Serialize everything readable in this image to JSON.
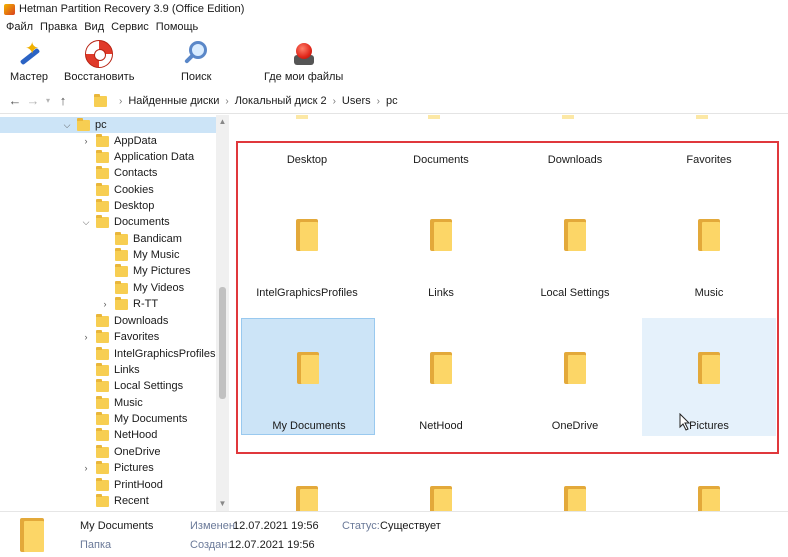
{
  "window": {
    "title": "Hetman Partition Recovery 3.9 (Office Edition)",
    "app_icon": "app-logo-icon"
  },
  "menu": [
    "Файл",
    "Правка",
    "Вид",
    "Сервис",
    "Помощь"
  ],
  "toolbar": {
    "wizard_label": "Мастер",
    "restore_label": "Восстановить",
    "search_label": "Поиск",
    "where_label": "Где мои файлы"
  },
  "address": {
    "back": "←",
    "forward": "→",
    "recent": "▾",
    "up": "↑",
    "sep": "›",
    "crumbs": [
      "Найденные диски",
      "Локальный диск 2",
      "Users",
      "pc"
    ]
  },
  "tree": {
    "root": "pc",
    "children": [
      "AppData",
      "Application Data",
      "Contacts",
      "Cookies",
      "Desktop",
      "Documents"
    ],
    "documents_children": [
      "Bandicam",
      "My Music",
      "My Pictures",
      "My Videos",
      "R-TT"
    ],
    "after": [
      "Downloads",
      "Favorites",
      "IntelGraphicsProfiles",
      "Links",
      "Local Settings",
      "Music",
      "My Documents",
      "NetHood",
      "OneDrive",
      "Pictures",
      "PrintHood",
      "Recent"
    ]
  },
  "grid": {
    "row1": [
      "Desktop",
      "Documents",
      "Downloads",
      "Favorites"
    ],
    "row2": [
      "IntelGraphicsProfiles",
      "Links",
      "Local Settings",
      "Music"
    ],
    "row3": [
      "My Documents",
      "NetHood",
      "OneDrive",
      "Pictures"
    ]
  },
  "status": {
    "name": "My Documents",
    "type": "Папка",
    "modified_label": "Изменен:",
    "modified_value": "12.07.2021 19:56",
    "created_label": "Создан:",
    "created_value": "12.07.2021 19:56",
    "status_label": "Статус:",
    "status_value": "Существует"
  },
  "colors": {
    "selection": "#cce4f7",
    "highlight": "#e0383c",
    "folder": "#fcd667"
  }
}
